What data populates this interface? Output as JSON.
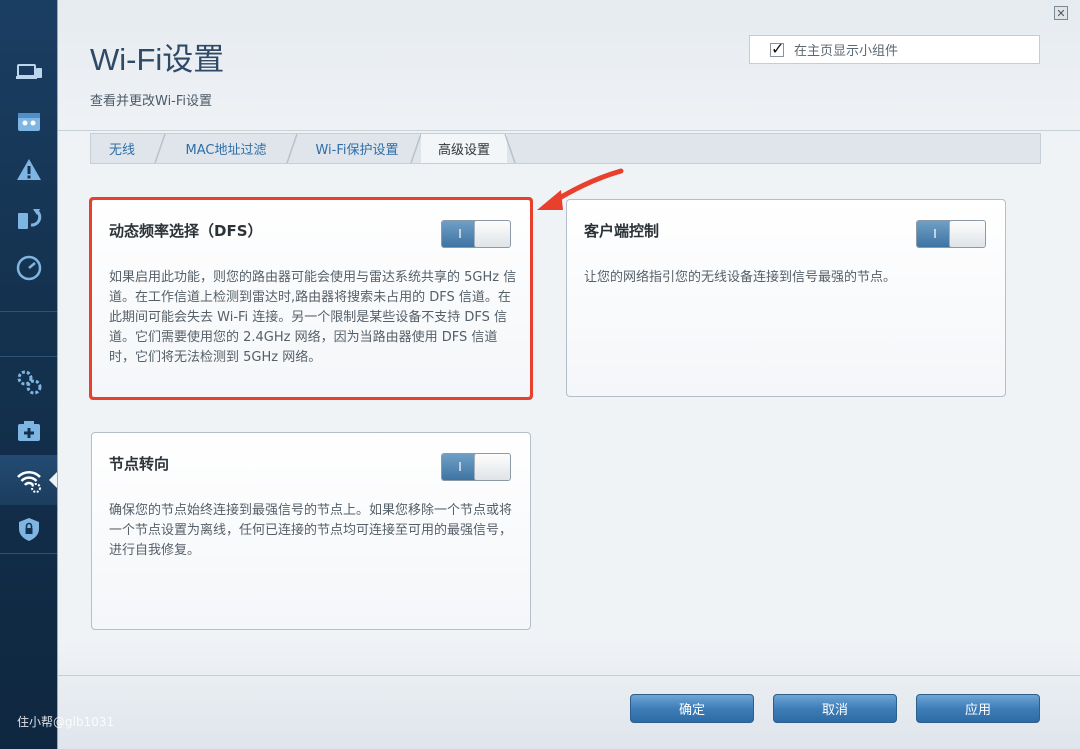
{
  "header": {
    "title": "Wi-Fi设置",
    "subtitle": "查看并更改Wi-Fi设置",
    "show_widget_label": "在主页显示小组件",
    "show_widget_checked": true
  },
  "tabs": [
    {
      "label": "无线",
      "active": false
    },
    {
      "label": "MAC地址过滤",
      "active": false
    },
    {
      "label": "Wi-Fi保护设置",
      "active": false
    },
    {
      "label": "高级设置",
      "active": true
    }
  ],
  "cards": {
    "dfs": {
      "title": "动态频率选择（DFS）",
      "toggle_label": "I",
      "toggle_on": true,
      "description": "如果启用此功能，则您的路由器可能会使用与雷达系统共享的 5GHz 信道。在工作信道上检测到雷达时,路由器将搜索未占用的 DFS 信道。在此期间可能会失去 Wi-Fi 连接。另一个限制是某些设备不支持 DFS 信道。它们需要使用您的 2.4GHz 网络，因为当路由器使用 DFS 信道时，它们将无法检测到 5GHz 网络。"
    },
    "client_steering": {
      "title": "客户端控制",
      "toggle_label": "I",
      "toggle_on": true,
      "description": "让您的网络指引您的无线设备连接到信号最强的节点。"
    },
    "node_steering": {
      "title": "节点转向",
      "toggle_label": "I",
      "toggle_on": true,
      "description": "确保您的节点始终连接到最强信号的节点上。如果您移除一个节点或将一个节点设置为离线，任何已连接的节点均可连接至可用的最强信号，进行自我修复。"
    }
  },
  "footer": {
    "ok_label": "确定",
    "cancel_label": "取消",
    "apply_label": "应用"
  },
  "window": {
    "close_label": "✕"
  },
  "sidebar": {
    "icons": [
      "devices-icon",
      "parental-controls-icon",
      "troubleshooting-icon",
      "update-icon",
      "speed-test-icon",
      "settings-icon",
      "external-storage-icon",
      "wifi-settings-icon",
      "security-icon"
    ],
    "active": "wifi-settings-icon"
  },
  "watermark": "住小帮@glb1031",
  "colors": {
    "accent": "#3d7db8",
    "highlight": "#e8402c",
    "sidebar": "#14324f"
  }
}
